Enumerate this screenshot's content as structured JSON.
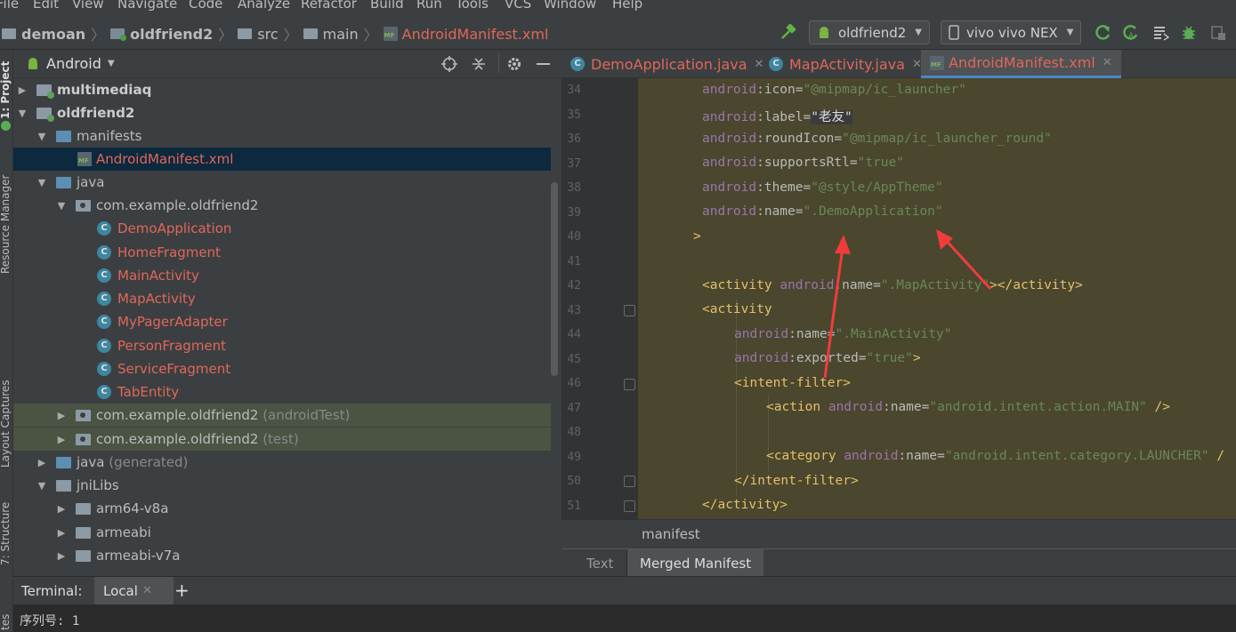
{
  "menu": [
    "File",
    "Edit",
    "View",
    "Navigate",
    "Code",
    "Analyze",
    "Refactor",
    "Build",
    "Run",
    "Tools",
    "VCS",
    "Window",
    "Help"
  ],
  "breadcrumb": {
    "root": "demoan",
    "module": "oldfriend2",
    "src": "src",
    "main": "main",
    "file": "AndroidManifest.xml"
  },
  "toolbar": {
    "run_config": "oldfriend2",
    "device": "vivo vivo NEX"
  },
  "side_labels": {
    "project": "1: Project",
    "resource_manager": "Resource Manager",
    "layout_captures": "Layout Captures",
    "structure": "7: Structure",
    "favorites": "tes"
  },
  "project_panel": {
    "view_mode": "Android",
    "tree": [
      {
        "label": "multimediaq",
        "bold": true
      },
      {
        "label": "oldfriend2",
        "bold": true
      },
      {
        "label": "manifests"
      },
      {
        "label": "AndroidManifest.xml"
      },
      {
        "label": "java"
      },
      {
        "label": "com.example.oldfriend2"
      },
      {
        "label": "DemoApplication"
      },
      {
        "label": "HomeFragment"
      },
      {
        "label": "MainActivity"
      },
      {
        "label": "MapActivity"
      },
      {
        "label": "MyPagerAdapter"
      },
      {
        "label": "PersonFragment"
      },
      {
        "label": "ServiceFragment"
      },
      {
        "label": "TabEntity"
      },
      {
        "label": "com.example.oldfriend2",
        "suffix": "(androidTest)"
      },
      {
        "label": "com.example.oldfriend2",
        "suffix": "(test)"
      },
      {
        "label": "java",
        "suffix": "(generated)"
      },
      {
        "label": "jniLibs"
      },
      {
        "label": "arm64-v8a"
      },
      {
        "label": "armeabi"
      },
      {
        "label": "armeabi-v7a"
      }
    ]
  },
  "editor_tabs": [
    {
      "label": "DemoApplication.java"
    },
    {
      "label": "MapActivity.java"
    },
    {
      "label": "AndroidManifest.xml",
      "active": true
    }
  ],
  "code_lines": {
    "numbers": [
      "34",
      "35",
      "36",
      "37",
      "38",
      "39",
      "40",
      "41",
      "42",
      "43",
      "44",
      "45",
      "46",
      "47",
      "48",
      "49",
      "50",
      "51"
    ],
    "l34": {
      "ns": "android",
      "attr": "icon",
      "val": "\"@mipmap/ic_launcher\""
    },
    "l35": {
      "ns": "android",
      "attr": "label",
      "val": "\"老友\""
    },
    "l36": {
      "ns": "android",
      "attr": "roundIcon",
      "val": "\"@mipmap/ic_launcher_round\""
    },
    "l37": {
      "ns": "android",
      "attr": "supportsRtl",
      "val": "\"true\""
    },
    "l38": {
      "ns": "android",
      "attr": "theme",
      "val": "\"@style/AppTheme\""
    },
    "l39": {
      "ns": "android",
      "attr": "name",
      "val": "\".DemoApplication\""
    },
    "l40": {
      "text": ">"
    },
    "l42": {
      "open": "<activity",
      "ns": "android",
      "attr": "name",
      "val": "\".MapActivity\"",
      "close": "></activity>"
    },
    "l43": {
      "open": "<activity"
    },
    "l44": {
      "ns": "android",
      "attr": "name",
      "val": "\".MainActivity\""
    },
    "l45": {
      "ns": "android",
      "attr": "exported",
      "val": "\"true\"",
      "close": ">"
    },
    "l46": {
      "open": "<intent-filter>"
    },
    "l47": {
      "open": "<action",
      "ns": "android",
      "attr": "name",
      "val": "\"android.intent.action.MAIN\"",
      "close": " />"
    },
    "l49": {
      "open": "<category",
      "ns": "android",
      "attr": "name",
      "val": "\"android.intent.category.LAUNCHER\"",
      "close": " /"
    },
    "l50": {
      "open": "</intent-filter>"
    },
    "l51": {
      "open": "</activity>"
    }
  },
  "editor_breadcrumb": "manifest",
  "bottom_tabs": [
    "Text",
    "Merged Manifest"
  ],
  "terminal": {
    "title": "Terminal:",
    "tab": "Local",
    "output": "序列号: 1"
  },
  "colors": {
    "editor_bg": "#4a472e",
    "tree_selection": "#0d293e",
    "modified_file": "#e0675a",
    "annotation_arrow": "#f03c3c"
  }
}
